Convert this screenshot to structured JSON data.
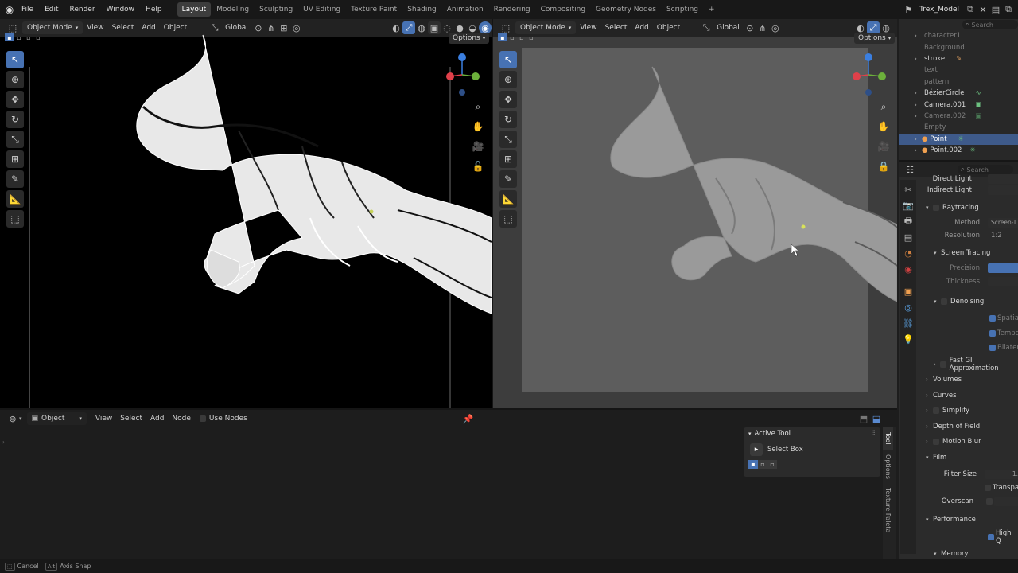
{
  "topbar": {
    "menus": [
      "File",
      "Edit",
      "Render",
      "Window",
      "Help"
    ],
    "workspaces": [
      "Layout",
      "Modeling",
      "Sculpting",
      "UV Editing",
      "Texture Paint",
      "Shading",
      "Animation",
      "Rendering",
      "Compositing",
      "Geometry Nodes",
      "Scripting"
    ],
    "active_workspace": "Layout",
    "add_tab": "+",
    "scene_name": "Trex_Model"
  },
  "viewport_left": {
    "mode": "Object Mode",
    "menus": [
      "View",
      "Select",
      "Add",
      "Object"
    ],
    "orientation": "Global",
    "options": "Options"
  },
  "viewport_right": {
    "mode": "Object Mode",
    "menus": [
      "View",
      "Select",
      "Add",
      "Object"
    ],
    "orientation": "Global",
    "options": "Options"
  },
  "outliner": {
    "search_placeholder": "Search",
    "items": [
      {
        "label": "character1",
        "style": "dim"
      },
      {
        "label": "Background",
        "style": "dim"
      },
      {
        "label": "stroke",
        "style": "normal"
      },
      {
        "label": "text",
        "style": "dim"
      },
      {
        "label": "pattern",
        "style": "dim"
      },
      {
        "label": "BézierCircle",
        "style": "normal"
      },
      {
        "label": "Camera.001",
        "style": "normal"
      },
      {
        "label": "Camera.002",
        "style": "dim"
      },
      {
        "label": "Empty",
        "style": "dim"
      },
      {
        "label": "Point",
        "style": "selected"
      },
      {
        "label": "Point.002",
        "style": "normal"
      }
    ]
  },
  "properties": {
    "search_placeholder": "Search",
    "direct_light": "Direct Light",
    "indirect_light": "Indirect Light",
    "raytracing": "Raytracing",
    "method_label": "Method",
    "method_value": "Screen-T",
    "resolution_label": "Resolution",
    "resolution_value": "1:2",
    "screen_tracing": "Screen Tracing",
    "precision_label": "Precision",
    "thickness_label": "Thickness",
    "denoising": "Denoising",
    "spatial": "Spatial",
    "temporal": "Tempo",
    "bilateral": "Bilatera",
    "fast_gi": "Fast GI Approximation",
    "volumes": "Volumes",
    "curves": "Curves",
    "simplify": "Simplify",
    "dof": "Depth of Field",
    "motion_blur": "Motion Blur",
    "film": "Film",
    "filter_size_label": "Filter Size",
    "filter_size_value": "1.",
    "transparent": "Transpar",
    "overscan": "Overscan",
    "performance": "Performance",
    "high_quality": "High Q",
    "memory": "Memory"
  },
  "node_editor": {
    "object_type": "Object",
    "menus": [
      "View",
      "Select",
      "Add",
      "Node"
    ],
    "use_nodes": "Use Nodes"
  },
  "active_tool": {
    "title": "Active Tool",
    "tool_name": "Select Box",
    "sidebar_tabs": [
      "Tool",
      "Options",
      "Texture Paleta"
    ]
  },
  "statusbar": {
    "cancel": "Cancel",
    "alt_key": "Alt",
    "axis_snap": "Axis Snap"
  },
  "colors": {
    "accent": "#4772b3",
    "selected_row": "#3e5a8a",
    "axis_x": "#e0404a",
    "axis_y": "#6cb03b",
    "axis_z": "#3b7fe0"
  }
}
